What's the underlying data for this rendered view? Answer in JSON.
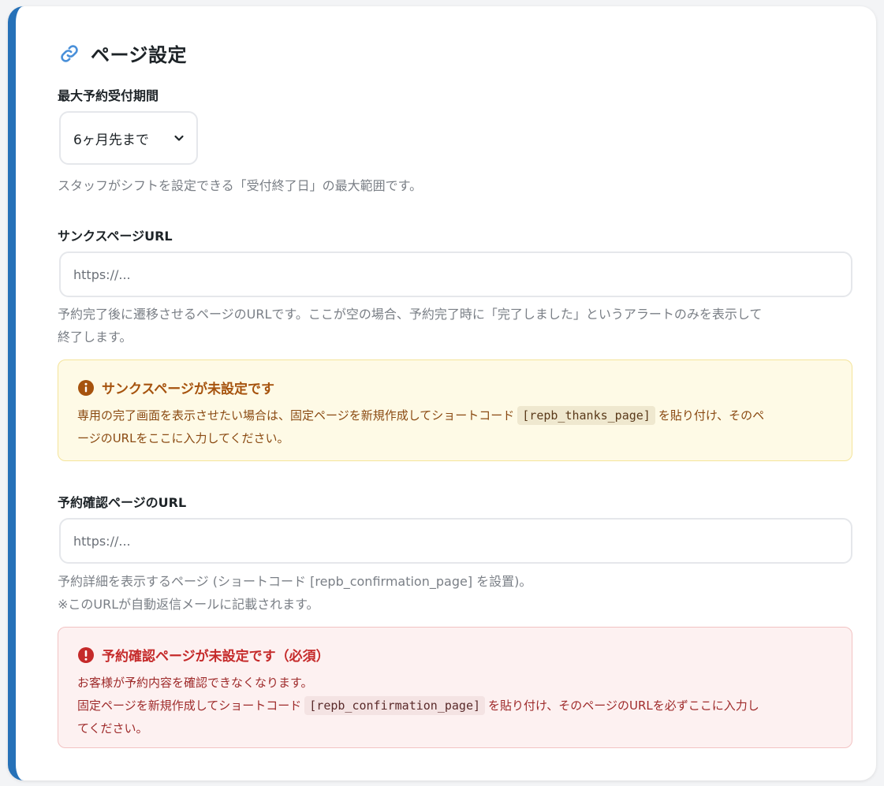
{
  "section": {
    "title": "ページ設定",
    "icon": "link-icon"
  },
  "max_period": {
    "label": "最大予約受付期間",
    "selected": "6ヶ月先まで",
    "help": "スタッフがシフトを設定できる「受付終了日」の最大範囲です。"
  },
  "thanks": {
    "label": "サンクスページURL",
    "placeholder": "https://...",
    "help_line1": "予約完了後に遷移させるページのURLです。ここが空の場合、予約完了時に「完了しました」というアラートのみを表示して",
    "help_line2": "終了します。",
    "notice": {
      "title": "サンクスページが未設定です",
      "text_before": "専用の完了画面を表示させたい場合は、固定ページを新規作成してショートコード",
      "code": "[repb_thanks_page]",
      "text_after": "を貼り付け、そのペ",
      "text_line2": "ージのURLをここに入力してください。",
      "color": "#a6530e"
    }
  },
  "confirmation": {
    "label": "予約確認ページのURL",
    "placeholder": "https://...",
    "help_line1": "予約詳細を表示するページ (ショートコード [repb_confirmation_page] を設置)。",
    "help_line2": "※このURLが自動返信メールに記載されます。",
    "notice": {
      "title": "予約確認ページが未設定です（必須）",
      "line1": "お客様が予約内容を確認できなくなります。",
      "text_before": "固定ページを新規作成してショートコード",
      "code": "[repb_confirmation_page]",
      "text_after": "を貼り付け、そのページのURLを必ずここに入力し",
      "text_line3": "てください。",
      "color": "#c52a2a"
    }
  },
  "colors": {
    "accent": "#2671b8",
    "warning_bg": "#fefae6",
    "error_bg": "#fdf1f1"
  }
}
